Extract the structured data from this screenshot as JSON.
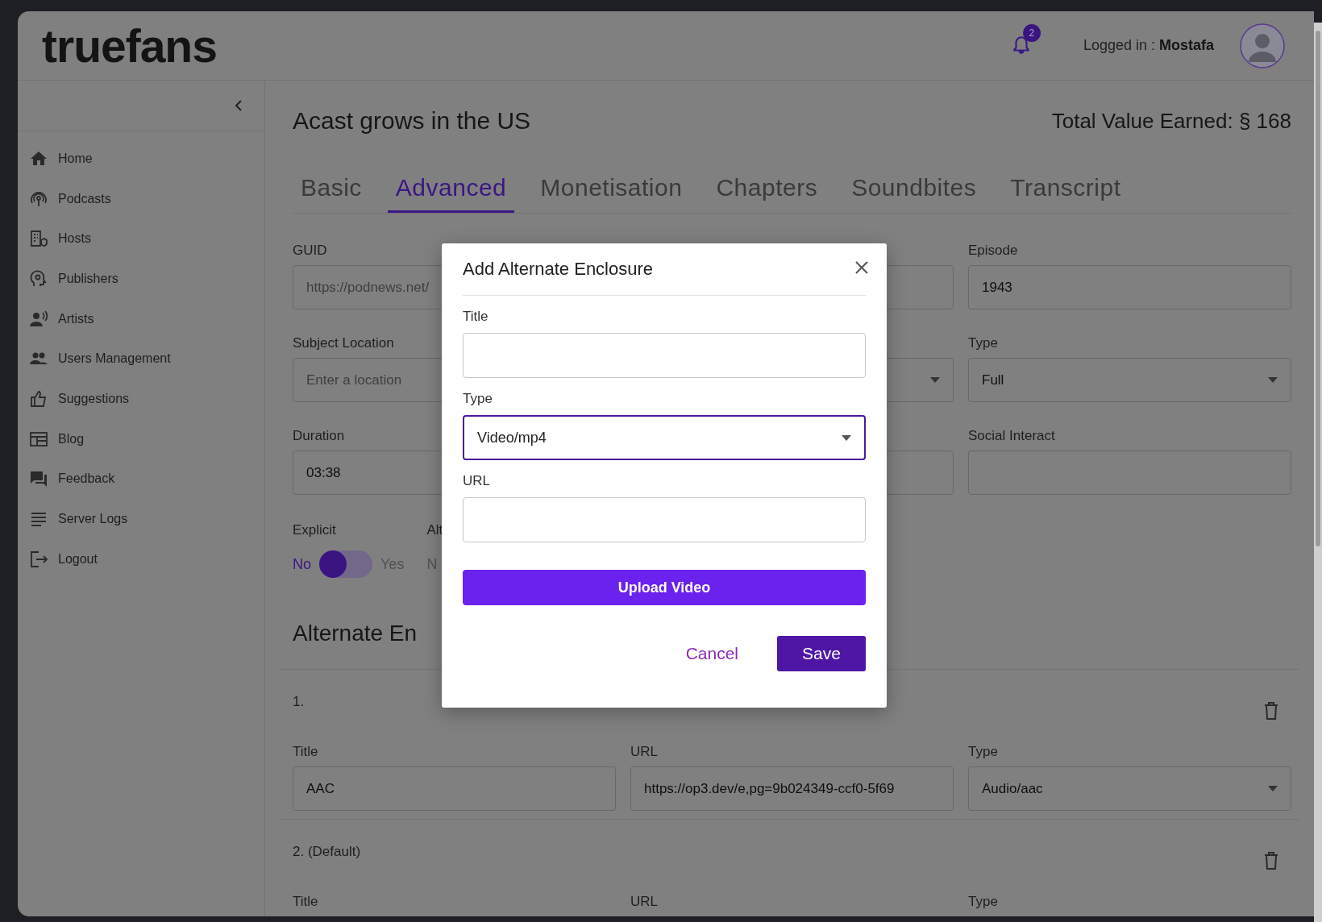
{
  "header": {
    "logo": "truefans",
    "notification_count": "2",
    "login_label": "Logged in :",
    "user": "Mostafa"
  },
  "sidebar": {
    "items": [
      {
        "label": "Home"
      },
      {
        "label": "Podcasts"
      },
      {
        "label": "Hosts"
      },
      {
        "label": "Publishers"
      },
      {
        "label": "Artists"
      },
      {
        "label": "Users Management"
      },
      {
        "label": "Suggestions"
      },
      {
        "label": "Blog"
      },
      {
        "label": "Feedback"
      },
      {
        "label": "Server Logs"
      },
      {
        "label": "Logout"
      }
    ]
  },
  "page": {
    "title": "Acast grows in the US",
    "total": "Total Value Earned: § 168"
  },
  "tabs": [
    {
      "label": "Basic",
      "selected": false
    },
    {
      "label": "Advanced",
      "selected": true
    },
    {
      "label": "Monetisation",
      "selected": false
    },
    {
      "label": "Chapters",
      "selected": false
    },
    {
      "label": "Soundbites",
      "selected": false
    },
    {
      "label": "Transcript",
      "selected": false
    }
  ],
  "fields": [
    {
      "label": "GUID",
      "kind": "input",
      "placeholder": "https://podnews.net/"
    },
    {
      "kind": "input"
    },
    {
      "label": "Episode",
      "kind": "input",
      "value": "1943"
    },
    {
      "label": "Subject Location",
      "kind": "input",
      "placeholder": "Enter a location"
    },
    {
      "kind": "select"
    },
    {
      "label": "Type",
      "kind": "select",
      "value": "Full"
    },
    {
      "label": "Duration",
      "kind": "input",
      "value": "03:38"
    },
    {
      "kind": "input"
    },
    {
      "label": "Social Interact",
      "kind": "input"
    }
  ],
  "explicit": {
    "label": "Explicit",
    "off_label": "No",
    "on_label": "Yes",
    "on": false
  },
  "alt": {
    "label": "Alt",
    "off_label": "N"
  },
  "section_title": "Alternate En",
  "enclosures": [
    {
      "number": "1.",
      "fields": [
        {
          "label": "Title",
          "kind": "input",
          "value": "AAC"
        },
        {
          "label": "URL",
          "kind": "input",
          "value": "https://op3.dev/e,pg=9b024349-ccf0-5f69"
        },
        {
          "label": "Type",
          "kind": "select",
          "value": "Audio/aac"
        }
      ]
    },
    {
      "number": "2. (Default)",
      "fields": [
        {
          "label": "Title"
        },
        {
          "label": "URL"
        },
        {
          "label": "Type"
        }
      ]
    }
  ],
  "modal": {
    "title": "Add Alternate Enclosure",
    "fields": [
      {
        "label": "Title",
        "kind": "input",
        "focused": false
      },
      {
        "label": "Type",
        "kind": "select",
        "value": "Video/mp4",
        "focused": true
      },
      {
        "label": "URL",
        "kind": "input",
        "focused": false
      }
    ],
    "upload": "Upload Video",
    "cancel": "Cancel",
    "save": "Save"
  }
}
